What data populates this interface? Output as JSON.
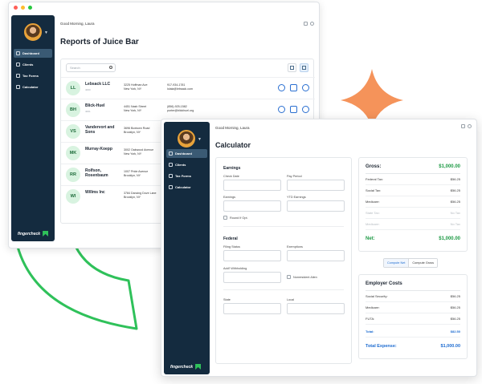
{
  "user": {
    "greeting": "Good Morning, Laura"
  },
  "back_window": {
    "title": "Reports of Juice Bar",
    "search_placeholder": "Search",
    "nav": [
      {
        "label": "Dashboard",
        "icon": "dashboard-icon",
        "active": true
      },
      {
        "label": "Clients",
        "icon": "users-icon"
      },
      {
        "label": "Tax Forms",
        "icon": "document-icon"
      },
      {
        "label": "Calculator",
        "icon": "calculator-icon"
      }
    ],
    "clients": [
      {
        "initials": "LL",
        "name": "Lebsack LLC",
        "sub": "4000",
        "addr1": "3225 Hoffman Ave",
        "addr2": "New York, NY",
        "contact1": "917-934-1781",
        "contact2": "lolala@lebsack.com"
      },
      {
        "initials": "BH",
        "name": "Blick-Huel",
        "sub": "4001",
        "addr1": "4451 Nash Street",
        "addr2": "New York, NY",
        "contact1": "(856)-925-1582",
        "contact2": "porter@blickhuel.org"
      },
      {
        "initials": "VS",
        "name": "Vandervort and Sons",
        "sub": "",
        "addr1": "3696 Boxtown Road",
        "addr2": "Brooklyn, NY",
        "contact1": "",
        "contact2": ""
      },
      {
        "initials": "MK",
        "name": "Murray-Koepp",
        "sub": "",
        "addr1": "3002 Oakwood Avenue",
        "addr2": "New York, NY",
        "contact1": "",
        "contact2": ""
      },
      {
        "initials": "RR",
        "name": "Rolfson, Rosenbaum",
        "sub": "",
        "addr1": "1007 Pride Avenue",
        "addr2": "Brooklyn, NY",
        "contact1": "",
        "contact2": ""
      },
      {
        "initials": "WI",
        "name": "Willms Inc",
        "sub": "",
        "addr1": "3784 Dancing Dove Lane",
        "addr2": "Brooklyn, NY",
        "contact1": "",
        "contact2": ""
      }
    ]
  },
  "brand": {
    "name": "fingercheck"
  },
  "front_window": {
    "title": "Calculator",
    "nav": [
      {
        "label": "Dashboard",
        "active": true
      },
      {
        "label": "Clients"
      },
      {
        "label": "Tax Forms"
      },
      {
        "label": "Calculator"
      }
    ],
    "earnings": {
      "section": "Earnings",
      "check_date": "Check Date",
      "pay_period": "Pay Period",
      "earnings": "Earnings",
      "ytd_earnings": "YTD Earnings",
      "round_if_opt": "Round If Opt."
    },
    "federal": {
      "section": "Federal",
      "filing_status": "Filing Status",
      "exemptions": "Exemptions",
      "addl_withholding": "Add'l Withholding",
      "nonresident_alien": "Nonresident Alien",
      "state": "State",
      "local": "Local"
    },
    "results": {
      "gross_label": "Gross:",
      "gross_value": "$1,000.00",
      "federal_label": "Federal Tax:",
      "federal_value": "$56.25",
      "social_label": "Social Tax:",
      "social_value": "$56.25",
      "medicare_label": "Medicare:",
      "medicare_value": "$56.25",
      "state_label": "State Tax:",
      "state_value": "No Tax",
      "medicare2_label": "Medicare:",
      "medicare2_value": "No Tax",
      "net_label": "Net:",
      "net_value": "$1,000.00"
    },
    "compute": {
      "net": "Compute Net",
      "gross": "Compute Gross"
    },
    "employer": {
      "title": "Employer Costs",
      "social_label": "Social Security:",
      "social_value": "$56.25",
      "medicare_label": "Medicare:",
      "medicare_value": "$56.25",
      "futa_label": "FUTA:",
      "futa_value": "$56.25",
      "total_label": "Total:",
      "total_value": "$82.50",
      "expense_label": "Total Expense:",
      "expense_value": "$1,000.00"
    }
  },
  "colors": {
    "sidebar": "#142b3f",
    "accent_green": "#2fc15a",
    "accent_orange": "#f5935a",
    "link_blue": "#1c6bd0"
  }
}
